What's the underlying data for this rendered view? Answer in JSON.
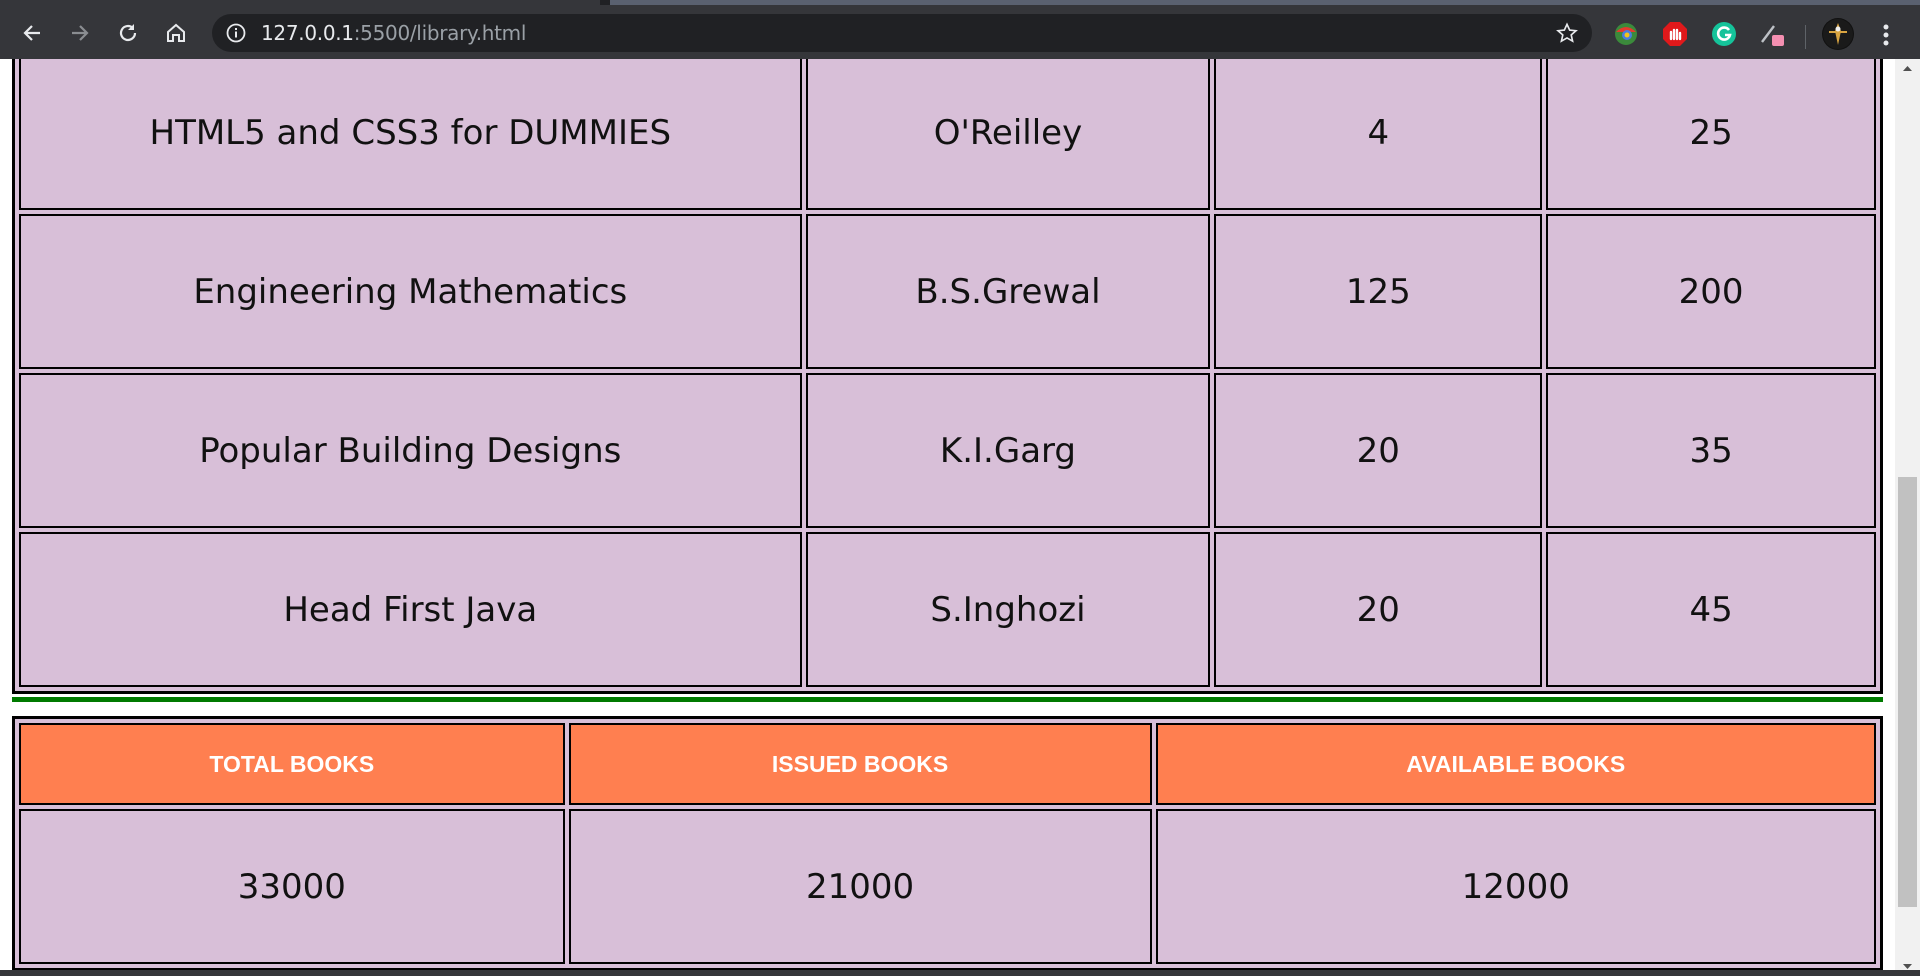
{
  "browser": {
    "url_host": "127.0.0.1",
    "url_rest": ":5500/library.html"
  },
  "books": [
    {
      "title": "HTML5 and CSS3 for DUMMIES",
      "author": "O'Reilley",
      "col3": "4",
      "col4": "25"
    },
    {
      "title": "Engineering Mathematics",
      "author": "B.S.Grewal",
      "col3": "125",
      "col4": "200"
    },
    {
      "title": "Popular Building Designs",
      "author": "K.I.Garg",
      "col3": "20",
      "col4": "35"
    },
    {
      "title": "Head First Java",
      "author": "S.Inghozi",
      "col3": "20",
      "col4": "45"
    }
  ],
  "summary": {
    "headers": [
      "TOTAL BOOKS",
      "ISSUED BOOKS",
      "AVAILABLE BOOKS"
    ],
    "values": [
      "33000",
      "21000",
      "12000"
    ]
  },
  "colors": {
    "cell_bg": "#d8bfd8",
    "header_bg": "#ff7f50",
    "rule": "#007a00"
  },
  "icons": {
    "back": "back-arrow-icon",
    "forward": "forward-arrow-icon",
    "reload": "reload-icon",
    "home": "home-icon",
    "info": "info-icon",
    "bookmark": "star-icon",
    "extensions": [
      "colorful-extension-icon",
      "adblock-hand-icon",
      "grammarly-icon",
      "pen-extension-icon"
    ],
    "profile": "profile-avatar",
    "menu": "kebab-menu-icon"
  }
}
